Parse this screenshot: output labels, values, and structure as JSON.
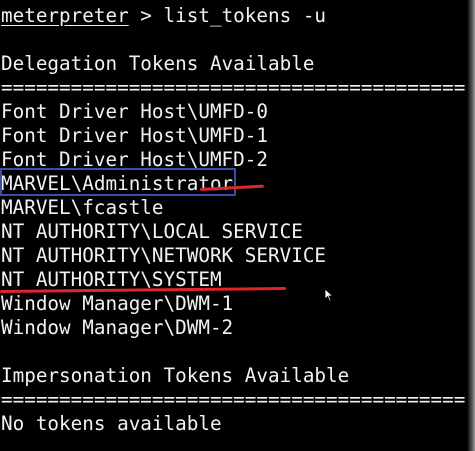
{
  "terminal": {
    "prompt": "meterpreter",
    "command": " > list_tokens -u",
    "delegation_header": "Delegation Tokens Available",
    "separator": "========================================",
    "delegation_tokens": [
      "Font Driver Host\\UMFD-0",
      "Font Driver Host\\UMFD-1",
      "Font Driver Host\\UMFD-2",
      "MARVEL\\Administrator",
      "MARVEL\\fcastle",
      "NT AUTHORITY\\LOCAL SERVICE",
      "NT AUTHORITY\\NETWORK SERVICE",
      "NT AUTHORITY\\SYSTEM",
      "Window Manager\\DWM-1",
      "Window Manager\\DWM-2"
    ],
    "impersonation_header": "Impersonation Tokens Available",
    "impersonation_separator": "========================================",
    "impersonation_tokens": [
      "No tokens available"
    ]
  },
  "colors": {
    "background": "#000000",
    "text": "#f2f2f2",
    "highlight_box": "#3a4fa8",
    "annotation_red": "#e0242b"
  },
  "icons": {
    "cursor": "mouse-pointer-icon"
  }
}
